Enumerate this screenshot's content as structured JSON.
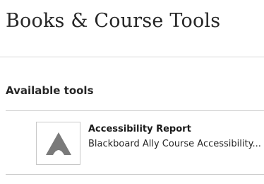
{
  "page": {
    "title": "Books & Course Tools"
  },
  "section": {
    "heading": "Available tools"
  },
  "tools": [
    {
      "title": "Accessibility Report",
      "description": "Blackboard Ally Course Accessibility...",
      "icon": "ally-logo-icon"
    }
  ],
  "colors": {
    "icon_gray": "#7a7a7a",
    "text": "#262626",
    "divider": "#d9d9d9"
  }
}
